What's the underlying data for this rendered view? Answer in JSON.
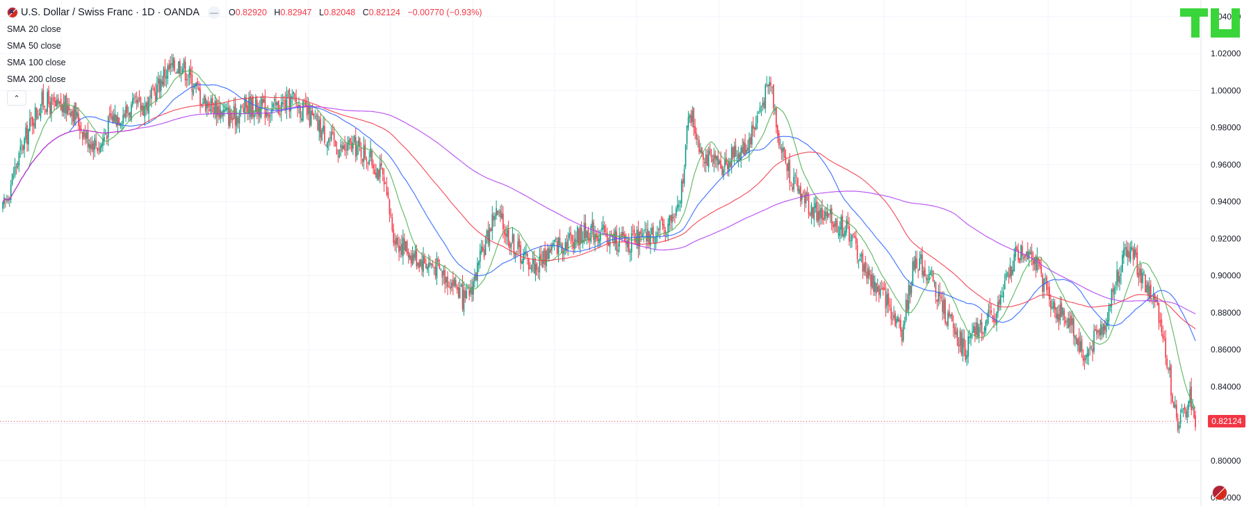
{
  "header": {
    "symbol_title": "U.S. Dollar / Swiss Franc · 1D · OANDA",
    "ohlc": {
      "o_label": "O",
      "o_value": "0.82920",
      "h_label": "H",
      "h_value": "0.82947",
      "l_label": "L",
      "l_value": "0.82048",
      "c_label": "C",
      "c_value": "0.82124",
      "change": "−0.00770 (−0.93%)"
    },
    "collapse_icon": "minus-icon"
  },
  "indicators": [
    {
      "name": "SMA",
      "arg": "20 close",
      "color": "#4caf50"
    },
    {
      "name": "SMA",
      "arg": "50 close",
      "color": "#2962ff"
    },
    {
      "name": "SMA",
      "arg": "100 close",
      "color": "#f23645"
    },
    {
      "name": "SMA",
      "arg": "200 close",
      "color": "#b03bf2"
    }
  ],
  "legend_toggle_icon": "chevron-up-icon",
  "logo_text": "TU",
  "last_price": "0.82124",
  "colors": {
    "up": "#089981",
    "down": "#f23645",
    "grid": "#f0f3fa",
    "price_line": "#f23645",
    "logo": "#3ad53a"
  },
  "chart_data": {
    "type": "candlestick",
    "ylim": [
      0.77,
      1.05
    ],
    "y_ticks": [
      "1.04000",
      "1.02000",
      "1.00000",
      "0.98000",
      "0.96000",
      "0.94000",
      "0.92000",
      "0.90000",
      "0.88000",
      "0.86000",
      "0.84000",
      "0.82000",
      "0.80000",
      "0.78000"
    ],
    "y_tick_values": [
      1.04,
      1.02,
      1.0,
      0.98,
      0.96,
      0.94,
      0.92,
      0.9,
      0.88,
      0.86,
      0.84,
      0.82,
      0.8,
      0.78
    ],
    "last_price": 0.82124,
    "price_path": [
      [
        0,
        0.935
      ],
      [
        10,
        0.96
      ],
      [
        22,
        0.985
      ],
      [
        30,
        0.995
      ],
      [
        40,
        0.99
      ],
      [
        50,
        0.992
      ],
      [
        62,
        0.975
      ],
      [
        72,
        0.97
      ],
      [
        80,
        0.985
      ],
      [
        95,
        0.99
      ],
      [
        108,
        0.993
      ],
      [
        120,
        1.01
      ],
      [
        132,
        1.015
      ],
      [
        148,
        0.995
      ],
      [
        160,
        0.99
      ],
      [
        170,
        0.985
      ],
      [
        180,
        0.992
      ],
      [
        200,
        0.99
      ],
      [
        215,
        0.995
      ],
      [
        228,
        0.985
      ],
      [
        240,
        0.975
      ],
      [
        250,
        0.968
      ],
      [
        260,
        0.97
      ],
      [
        270,
        0.965
      ],
      [
        280,
        0.955
      ],
      [
        290,
        0.92
      ],
      [
        305,
        0.91
      ],
      [
        320,
        0.905
      ],
      [
        335,
        0.895
      ],
      [
        342,
        0.885
      ],
      [
        352,
        0.905
      ],
      [
        364,
        0.935
      ],
      [
        375,
        0.92
      ],
      [
        385,
        0.91
      ],
      [
        395,
        0.905
      ],
      [
        405,
        0.915
      ],
      [
        420,
        0.92
      ],
      [
        435,
        0.925
      ],
      [
        450,
        0.92
      ],
      [
        465,
        0.918
      ],
      [
        475,
        0.92
      ],
      [
        488,
        0.925
      ],
      [
        500,
        0.935
      ],
      [
        508,
        0.99
      ],
      [
        516,
        0.97
      ],
      [
        524,
        0.96
      ],
      [
        532,
        0.96
      ],
      [
        540,
        0.965
      ],
      [
        550,
        0.97
      ],
      [
        560,
        0.99
      ],
      [
        568,
        1.005
      ],
      [
        575,
        0.97
      ],
      [
        585,
        0.95
      ],
      [
        600,
        0.935
      ],
      [
        612,
        0.93
      ],
      [
        625,
        0.925
      ],
      [
        640,
        0.9
      ],
      [
        655,
        0.885
      ],
      [
        665,
        0.87
      ],
      [
        675,
        0.91
      ],
      [
        685,
        0.9
      ],
      [
        700,
        0.875
      ],
      [
        712,
        0.86
      ],
      [
        720,
        0.87
      ],
      [
        735,
        0.88
      ],
      [
        748,
        0.91
      ],
      [
        760,
        0.915
      ],
      [
        770,
        0.895
      ],
      [
        780,
        0.88
      ],
      [
        790,
        0.875
      ],
      [
        800,
        0.855
      ],
      [
        815,
        0.875
      ],
      [
        826,
        0.905
      ],
      [
        834,
        0.915
      ],
      [
        845,
        0.895
      ],
      [
        855,
        0.88
      ],
      [
        860,
        0.86
      ],
      [
        868,
        0.82
      ],
      [
        874,
        0.825
      ],
      [
        878,
        0.835
      ],
      [
        882,
        0.821
      ]
    ],
    "x_range": [
      0,
      882
    ]
  }
}
